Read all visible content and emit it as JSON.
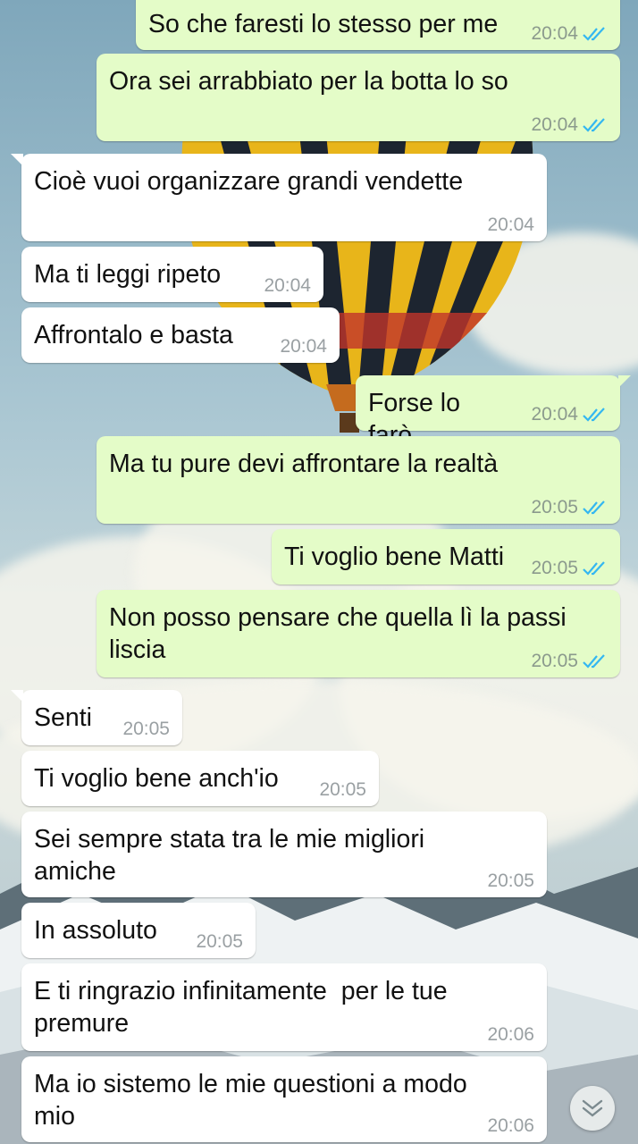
{
  "messages": [
    {
      "text": "So che faresti lo stesso per me",
      "time": "20:04",
      "direction": "out",
      "read": true
    },
    {
      "text": "Ora sei arrabbiato per la botta lo so",
      "time": "20:04",
      "direction": "out",
      "read": true
    },
    {
      "text": "Cioè vuoi organizzare grandi vendette",
      "time": "20:04",
      "direction": "in"
    },
    {
      "text": "Ma ti leggi ripeto",
      "time": "20:04",
      "direction": "in"
    },
    {
      "text": "Affrontalo e basta",
      "time": "20:04",
      "direction": "in"
    },
    {
      "text": "Forse lo farò",
      "time": "20:04",
      "direction": "out",
      "read": true
    },
    {
      "text": "Ma tu pure devi affrontare la realtà",
      "time": "20:05",
      "direction": "out",
      "read": true
    },
    {
      "text": "Ti voglio bene Matti",
      "time": "20:05",
      "direction": "out",
      "read": true
    },
    {
      "text": "Non posso pensare che quella lì la passi liscia",
      "time": "20:05",
      "direction": "out",
      "read": true
    },
    {
      "text": "Senti",
      "time": "20:05",
      "direction": "in"
    },
    {
      "text": "Ti voglio bene anch'io",
      "time": "20:05",
      "direction": "in"
    },
    {
      "text": "Sei sempre stata tra le mie migliori amiche",
      "time": "20:05",
      "direction": "in"
    },
    {
      "text": "In assoluto",
      "time": "20:05",
      "direction": "in"
    },
    {
      "text": "E ti ringrazio infinitamente  per le tue premure",
      "time": "20:06",
      "direction": "in"
    },
    {
      "text": "Ma io sistemo le mie questioni a modo mio",
      "time": "20:06",
      "direction": "in"
    }
  ],
  "icons": {
    "read_receipt": "double-check-icon",
    "scroll_down": "double-chevron-down-icon"
  },
  "colors": {
    "outgoing_bubble": "#e4fcc8",
    "incoming_bubble": "#ffffff",
    "read_tick": "#34b7f1"
  }
}
